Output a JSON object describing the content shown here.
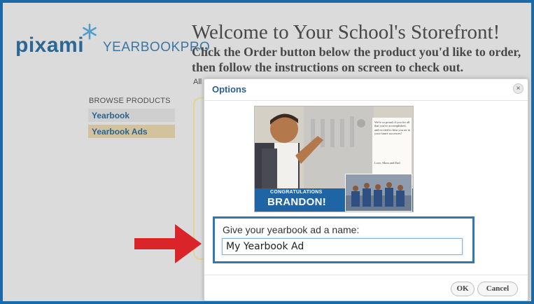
{
  "logo": {
    "pixami": "pixami",
    "yearbookpro": "YEARBOOKPRO"
  },
  "header": {
    "title": "Welcome to Your School's Storefront!",
    "instructions": "Click the Order button below the product you'd like to order, then follow the instructions on screen to check out.",
    "partial_text": "All"
  },
  "sidebar": {
    "title": "BROWSE PRODUCTS",
    "items": [
      {
        "label": "Yearbook"
      },
      {
        "label": "Yearbook Ads"
      }
    ]
  },
  "dialog": {
    "title": "Options",
    "close_glyph": "×",
    "ad": {
      "congrats": "CONGRATULATIONS",
      "name": "BRANDON!",
      "message": "We're so proud of you for all that you've accomplished, and excited to hear you on in your future successes!",
      "signature": "Love, Mom and Dad"
    },
    "name_label": "Give your yearbook ad a name:",
    "name_value": "My Yearbook Ad",
    "ok_label": "OK",
    "cancel_label": "Cancel"
  },
  "colors": {
    "frame": "#1a6aa8",
    "accent_blue": "#2d78b7",
    "arrow_red": "#d9242a",
    "selected_item": "#e0cfa8"
  },
  "icons": [
    "star-logo-icon",
    "close-icon",
    "red-arrow-icon"
  ]
}
